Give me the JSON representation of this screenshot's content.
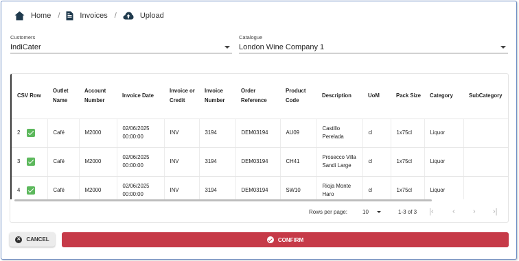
{
  "breadcrumb": [
    {
      "label": "Home",
      "icon": "home-icon"
    },
    {
      "label": "Invoices",
      "icon": "invoice-icon"
    },
    {
      "label": "Upload",
      "icon": "cloud-upload-icon"
    }
  ],
  "breadcrumb_separator": "/",
  "filters": {
    "customers": {
      "label": "Customers",
      "value": "IndiCater"
    },
    "catalogue": {
      "label": "Catalogue",
      "value": "London Wine Company 1"
    }
  },
  "table": {
    "columns": [
      "CSV Row",
      "Outlet Name",
      "Account Number",
      "Invoice Date",
      "Invoice or Credit",
      "Invoice Number",
      "Order Reference",
      "Product Code",
      "Description",
      "UoM",
      "Pack Size",
      "Category",
      "SubCategory"
    ],
    "rows": [
      {
        "csv_row": "2",
        "checked": true,
        "outlet": "Café",
        "account": "M2000",
        "date": "02/06/2025 00:00:00",
        "type": "INV",
        "invoice": "3194",
        "order": "DEM03194",
        "code": "AU09",
        "description": "Castillo Perelada",
        "uom": "cl",
        "pack": "1x75cl",
        "category": "Liquor",
        "subcategory": ""
      },
      {
        "csv_row": "3",
        "checked": true,
        "outlet": "Café",
        "account": "M2000",
        "date": "02/06/2025 00:00:00",
        "type": "INV",
        "invoice": "3194",
        "order": "DEM03194",
        "code": "CH41",
        "description": "Prosecco Villa Sandi Large",
        "uom": "cl",
        "pack": "1x75cl",
        "category": "Liquor",
        "subcategory": ""
      },
      {
        "csv_row": "4",
        "checked": true,
        "outlet": "Café",
        "account": "M2000",
        "date": "02/06/2025 00:00:00",
        "type": "INV",
        "invoice": "3194",
        "order": "DEM03194",
        "code": "SW10",
        "description": "Rioja Monte Haro",
        "uom": "cl",
        "pack": "1x75cl",
        "category": "Liquor",
        "subcategory": ""
      }
    ]
  },
  "pagination": {
    "rows_per_page_label": "Rows per page:",
    "rows_per_page": "10",
    "range": "1-3 of 3",
    "first": "|‹",
    "prev": "‹",
    "next": "›",
    "last": "›|"
  },
  "actions": {
    "cancel_label": "CANCEL",
    "confirm_label": "CONFIRM"
  },
  "colors": {
    "confirm": "#c63a48",
    "checkbox": "#5cb85c",
    "frame_border": "#6b8cc4"
  }
}
